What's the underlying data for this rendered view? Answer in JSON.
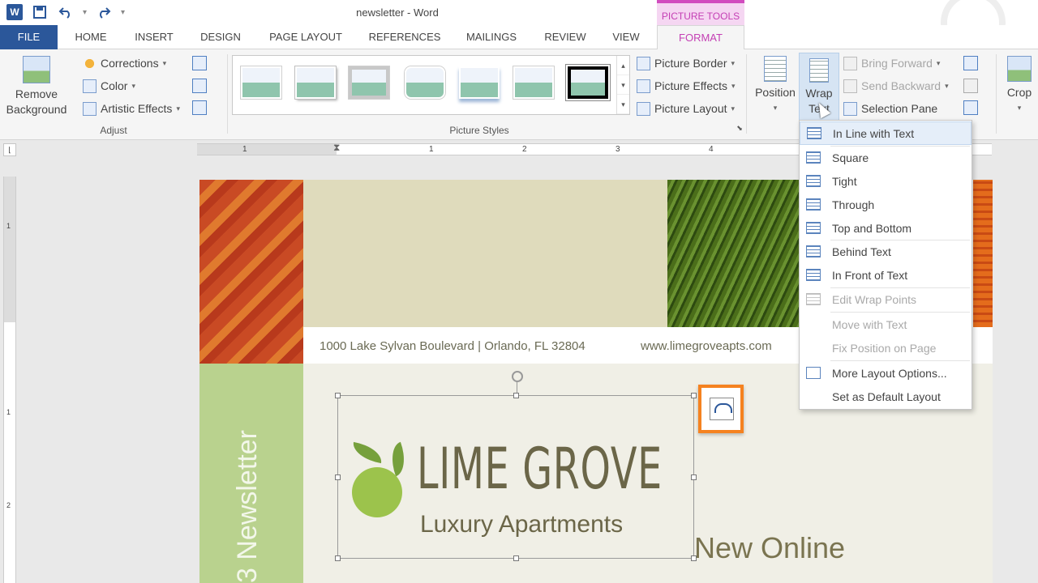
{
  "titlebar": {
    "title": "newsletter - Word",
    "context_tab": "PICTURE TOOLS",
    "app_icon_letter": "W"
  },
  "tabs": [
    "FILE",
    "HOME",
    "INSERT",
    "DESIGN",
    "PAGE LAYOUT",
    "REFERENCES",
    "MAILINGS",
    "REVIEW",
    "VIEW",
    "FORMAT"
  ],
  "ribbon": {
    "remove_background": "Remove Background",
    "corrections": "Corrections",
    "color": "Color",
    "artistic_effects": "Artistic Effects",
    "adjust_label": "Adjust",
    "picture_styles_label": "Picture Styles",
    "picture_border": "Picture Border",
    "picture_effects": "Picture Effects",
    "picture_layout": "Picture Layout",
    "position": "Position",
    "wrap_text_line1": "Wrap",
    "wrap_text_line2": "Text",
    "bring_forward": "Bring Forward",
    "send_backward": "Send Backward",
    "selection_pane": "Selection Pane",
    "crop": "Crop"
  },
  "ruler": {
    "h_numbers": [
      "1",
      "1",
      "2",
      "3",
      "4"
    ],
    "v_numbers": [
      "1",
      "1",
      "2"
    ]
  },
  "page": {
    "address": "1000 Lake Sylvan Boulevard | Orlando, FL 32804",
    "website": "www.limegroveapts.com",
    "vertical_text": "3 Newsletter",
    "logo_title": "LIME GROVE",
    "logo_subtitle": "Luxury Apartments",
    "heading": "New Online"
  },
  "wrap_menu": {
    "items": [
      {
        "label": "In Line with Text",
        "enabled": true
      },
      {
        "label": "Square",
        "enabled": true
      },
      {
        "label": "Tight",
        "enabled": true
      },
      {
        "label": "Through",
        "enabled": true
      },
      {
        "label": "Top and Bottom",
        "enabled": true
      },
      {
        "label": "Behind Text",
        "enabled": true
      },
      {
        "label": "In Front of Text",
        "enabled": true
      },
      {
        "label": "Edit Wrap Points",
        "enabled": false
      },
      {
        "label": "Move with Text",
        "enabled": false
      },
      {
        "label": "Fix Position on Page",
        "enabled": false
      },
      {
        "label": "More Layout Options...",
        "enabled": true
      },
      {
        "label": "Set as Default Layout",
        "enabled": true
      }
    ]
  },
  "colors": {
    "word_blue": "#2b579a",
    "context_magenta": "#c43fb4",
    "highlight_orange": "#f58220"
  },
  "icons": [
    "word-app-icon",
    "save-icon",
    "undo-icon",
    "redo-icon",
    "customize-icon",
    "wrap-text-icon",
    "layout-options-icon"
  ]
}
